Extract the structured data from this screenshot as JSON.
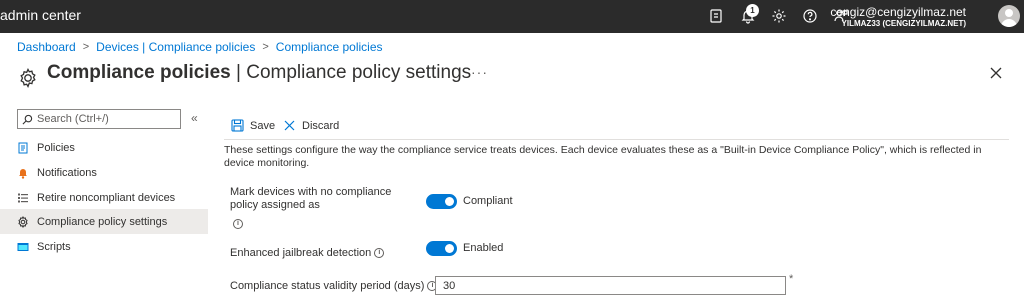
{
  "header": {
    "app_title": "admin center",
    "notification_count": "1",
    "user_email": "cengiz@cengizyilmaz.net",
    "user_tenant": "YILMAZ33 (CENGIZYILMAZ.NET)",
    "icons": [
      "feedback-icon",
      "bell-icon",
      "gear-icon",
      "help-icon",
      "person-feedback-icon"
    ]
  },
  "breadcrumb": {
    "items": [
      "Dashboard",
      "Devices | Compliance policies",
      "Compliance policies"
    ],
    "separator": ">"
  },
  "page": {
    "title_bold": "Compliance policies",
    "title_rest": " | Compliance policy settings",
    "more": "···"
  },
  "sidebar": {
    "search_placeholder": "Search (Ctrl+/)",
    "collapse": "«",
    "items": [
      {
        "label": "Policies",
        "icon": "policy-icon"
      },
      {
        "label": "Notifications",
        "icon": "notification-icon"
      },
      {
        "label": "Retire noncompliant devices",
        "icon": "list-icon"
      },
      {
        "label": "Compliance policy settings",
        "icon": "gear-icon"
      },
      {
        "label": "Scripts",
        "icon": "script-icon"
      }
    ]
  },
  "toolbar": {
    "save_label": "Save",
    "discard_label": "Discard"
  },
  "content": {
    "description": "These settings configure the way the compliance service treats devices. Each device evaluates these as a \"Built-in Device Compliance Policy\", which is reflected in device monitoring.",
    "settings": [
      {
        "label": "Mark devices with no compliance policy assigned as",
        "toggle_on": true,
        "value_text": "Compliant"
      },
      {
        "label": "Enhanced jailbreak detection",
        "toggle_on": true,
        "value_text": "Enabled"
      },
      {
        "label": "Compliance status validity period (days)",
        "input_value": "30",
        "required_mark": "*"
      }
    ]
  },
  "colors": {
    "topbar": "#2b2b2b",
    "accent": "#0078d4",
    "active_nav": "#edebe9"
  }
}
